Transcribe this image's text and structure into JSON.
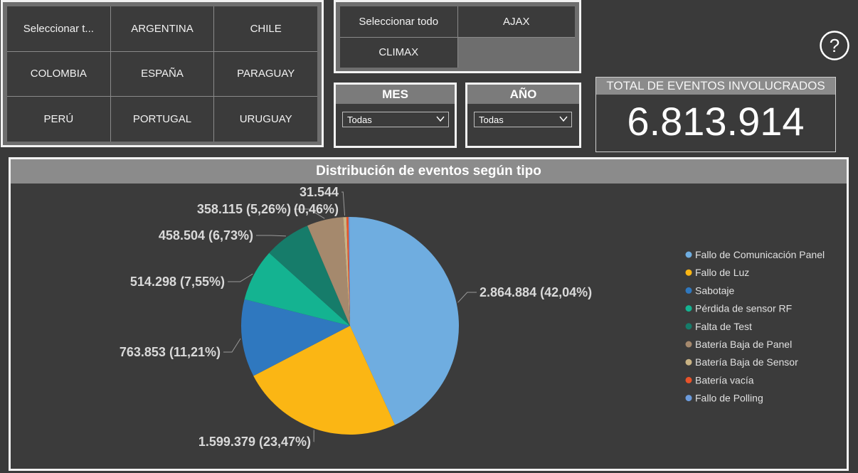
{
  "countries": {
    "items": [
      "Seleccionar t...",
      "ARGENTINA",
      "CHILE",
      "COLOMBIA",
      "ESPAÑA",
      "PARAGUAY",
      "PERÚ",
      "PORTUGAL",
      "URUGUAY"
    ]
  },
  "brands": {
    "items": [
      "Seleccionar todo",
      "AJAX",
      "CLIMAX"
    ]
  },
  "filters": {
    "mes": {
      "title": "MES",
      "value": "Todas"
    },
    "anio": {
      "title": "AÑO",
      "value": "Todas"
    }
  },
  "help_icon": "question-circle-icon",
  "total": {
    "label": "TOTAL DE EVENTOS INVOLUCRADOS",
    "value": "6.813.914"
  },
  "colors": {
    "background": "#3a3a3a",
    "frame_border": "#f2f2f2",
    "header_gray": "#8b8b8b"
  },
  "chart_data": {
    "type": "pie",
    "title": "Distribución de eventos según tipo",
    "legend_position": "right",
    "slices": [
      {
        "name": "Fallo de Comunicación Panel",
        "value": 2864884,
        "label": "2.864.884 (42,04%)",
        "color": "#6fade0"
      },
      {
        "name": "Fallo de Luz",
        "value": 1599379,
        "label": "1.599.379 (23,47%)",
        "color": "#fbb614"
      },
      {
        "name": "Sabotaje",
        "value": 763853,
        "label": "763.853 (11,21%)",
        "color": "#2f78bf"
      },
      {
        "name": "Pérdida de sensor RF",
        "value": 514298,
        "label": "514.298 (7,55%)",
        "color": "#14b391"
      },
      {
        "name": "Falta de Test",
        "value": 458504,
        "label": "458.504 (6,73%)",
        "color": "#167c6a"
      },
      {
        "name": "Batería Baja de Panel",
        "value": 358115,
        "label": "358.115 (5,26%)",
        "color": "#a5896d"
      },
      {
        "name": "Batería Baja de Sensor",
        "value": 31544,
        "label": "31.544 (0,46%)",
        "color": "#c9b384"
      },
      {
        "name": "Batería vacía",
        "value": 20000,
        "label": "",
        "color": "#e8532a"
      },
      {
        "name": "Fallo de Polling",
        "value": 15000,
        "label": "",
        "color": "#6b9bdc"
      }
    ]
  }
}
